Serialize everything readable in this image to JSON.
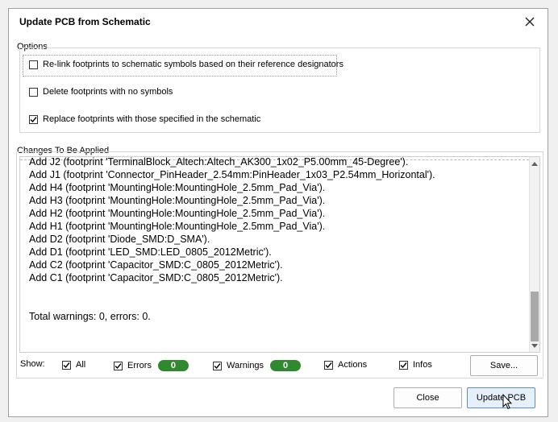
{
  "dialog": {
    "title": "Update PCB from Schematic"
  },
  "options": {
    "label": "Options",
    "items": [
      {
        "label": "Re-link footprints to schematic symbols based on their reference designators",
        "checked": false
      },
      {
        "label": "Delete footprints with no symbols",
        "checked": false
      },
      {
        "label": "Replace footprints with those specified in the schematic",
        "checked": true
      }
    ]
  },
  "changes": {
    "label": "Changes To Be Applied",
    "lines": [
      "Add J2 (footprint 'TerminalBlock_Altech:Altech_AK300_1x02_P5.00mm_45-Degree').",
      "Add J1 (footprint 'Connector_PinHeader_2.54mm:PinHeader_1x03_P2.54mm_Horizontal').",
      "Add H4 (footprint 'MountingHole:MountingHole_2.5mm_Pad_Via').",
      "Add H3 (footprint 'MountingHole:MountingHole_2.5mm_Pad_Via').",
      "Add H2 (footprint 'MountingHole:MountingHole_2.5mm_Pad_Via').",
      "Add H1 (footprint 'MountingHole:MountingHole_2.5mm_Pad_Via').",
      "Add D2 (footprint 'Diode_SMD:D_SMA').",
      "Add D1 (footprint 'LED_SMD:LED_0805_2012Metric').",
      "Add C2 (footprint 'Capacitor_SMD:C_0805_2012Metric').",
      "Add C1 (footprint 'Capacitor_SMD:C_0805_2012Metric')."
    ],
    "total": "Total warnings: 0, errors: 0."
  },
  "filters": {
    "show_label": "Show:",
    "all": {
      "label": "All",
      "checked": true
    },
    "errors": {
      "label": "Errors",
      "checked": true,
      "count": "0"
    },
    "warnings": {
      "label": "Warnings",
      "checked": true,
      "count": "0"
    },
    "actions": {
      "label": "Actions",
      "checked": true
    },
    "infos": {
      "label": "Infos",
      "checked": true
    },
    "save_label": "Save..."
  },
  "buttons": {
    "close": "Close",
    "update": "Update PCB"
  },
  "colors": {
    "badge_green": "#2f8a2f",
    "primary_button_bg": "#e6f0fa",
    "primary_button_border": "#5a8dd0"
  },
  "icons": {
    "close": "close-icon",
    "check": "checkmark-icon",
    "scroll_up": "chevron-up-icon",
    "scroll_down": "chevron-down-icon",
    "cursor": "mouse-pointer-icon"
  }
}
